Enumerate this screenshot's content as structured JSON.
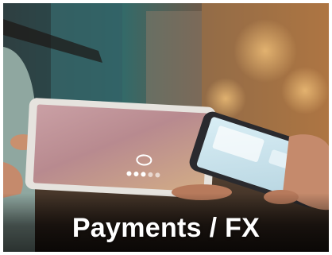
{
  "card": {
    "caption": "Payments / FX"
  },
  "scene": {
    "subject": "tablet-and-phone-contactless-payment",
    "colors": {
      "background_warm": "#a8703f",
      "background_teal": "#2f6b6b",
      "tablet_screen_a": "#b88a8f",
      "tablet_screen_b": "#c9a27d",
      "phone_screen": "#c7e0ea",
      "shirt": "#8fa7a0"
    }
  }
}
